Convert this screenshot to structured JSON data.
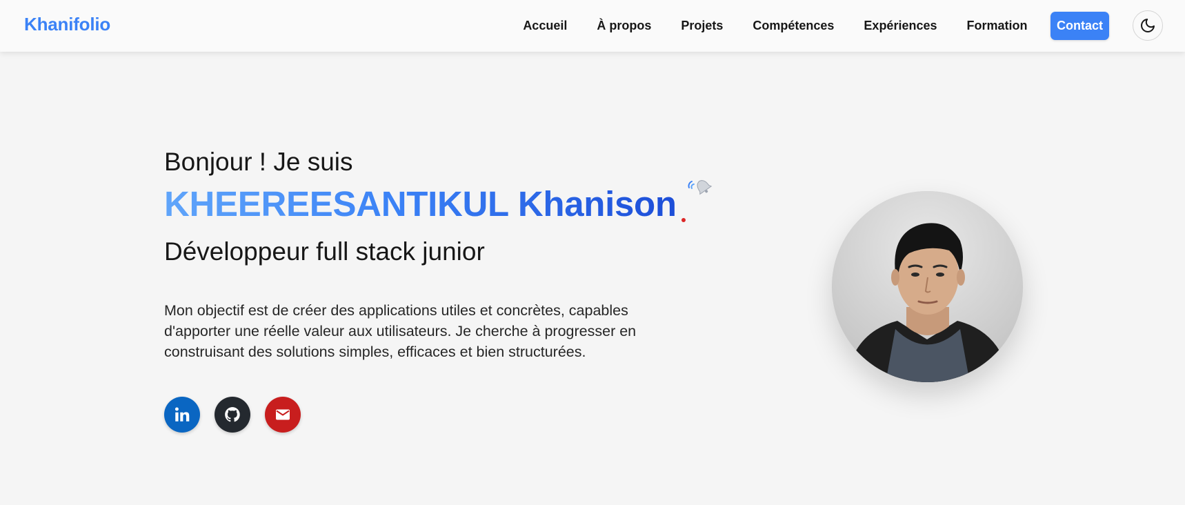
{
  "nav": {
    "brand": "Khanifolio",
    "links": [
      {
        "label": "Accueil"
      },
      {
        "label": "À propos"
      },
      {
        "label": "Projets"
      },
      {
        "label": "Compétences"
      },
      {
        "label": "Expériences"
      },
      {
        "label": "Formation"
      }
    ],
    "contact_label": "Contact",
    "theme_toggle_icon": "moon-icon"
  },
  "hero": {
    "greeting": "Bonjour ! Je suis",
    "name": "KHEEREESANTIKUL Khanison",
    "role": "Développeur full stack junior",
    "description": "Mon objectif est de créer des applications utiles et concrètes, capables d'apporter une réelle valeur aux utilisateurs. Je cherche à progresser en construisant des solutions simples, efficaces et bien structurées.",
    "socials": [
      {
        "icon": "linkedin-icon",
        "color": "#0a66c2"
      },
      {
        "icon": "github-icon",
        "color": "#24292f"
      },
      {
        "icon": "email-icon",
        "color": "#c81e1e"
      }
    ],
    "photo": "profile-photo"
  },
  "colors": {
    "accent": "#3b82f6",
    "background": "#f5f5f5",
    "navbar": "#fafafa"
  }
}
